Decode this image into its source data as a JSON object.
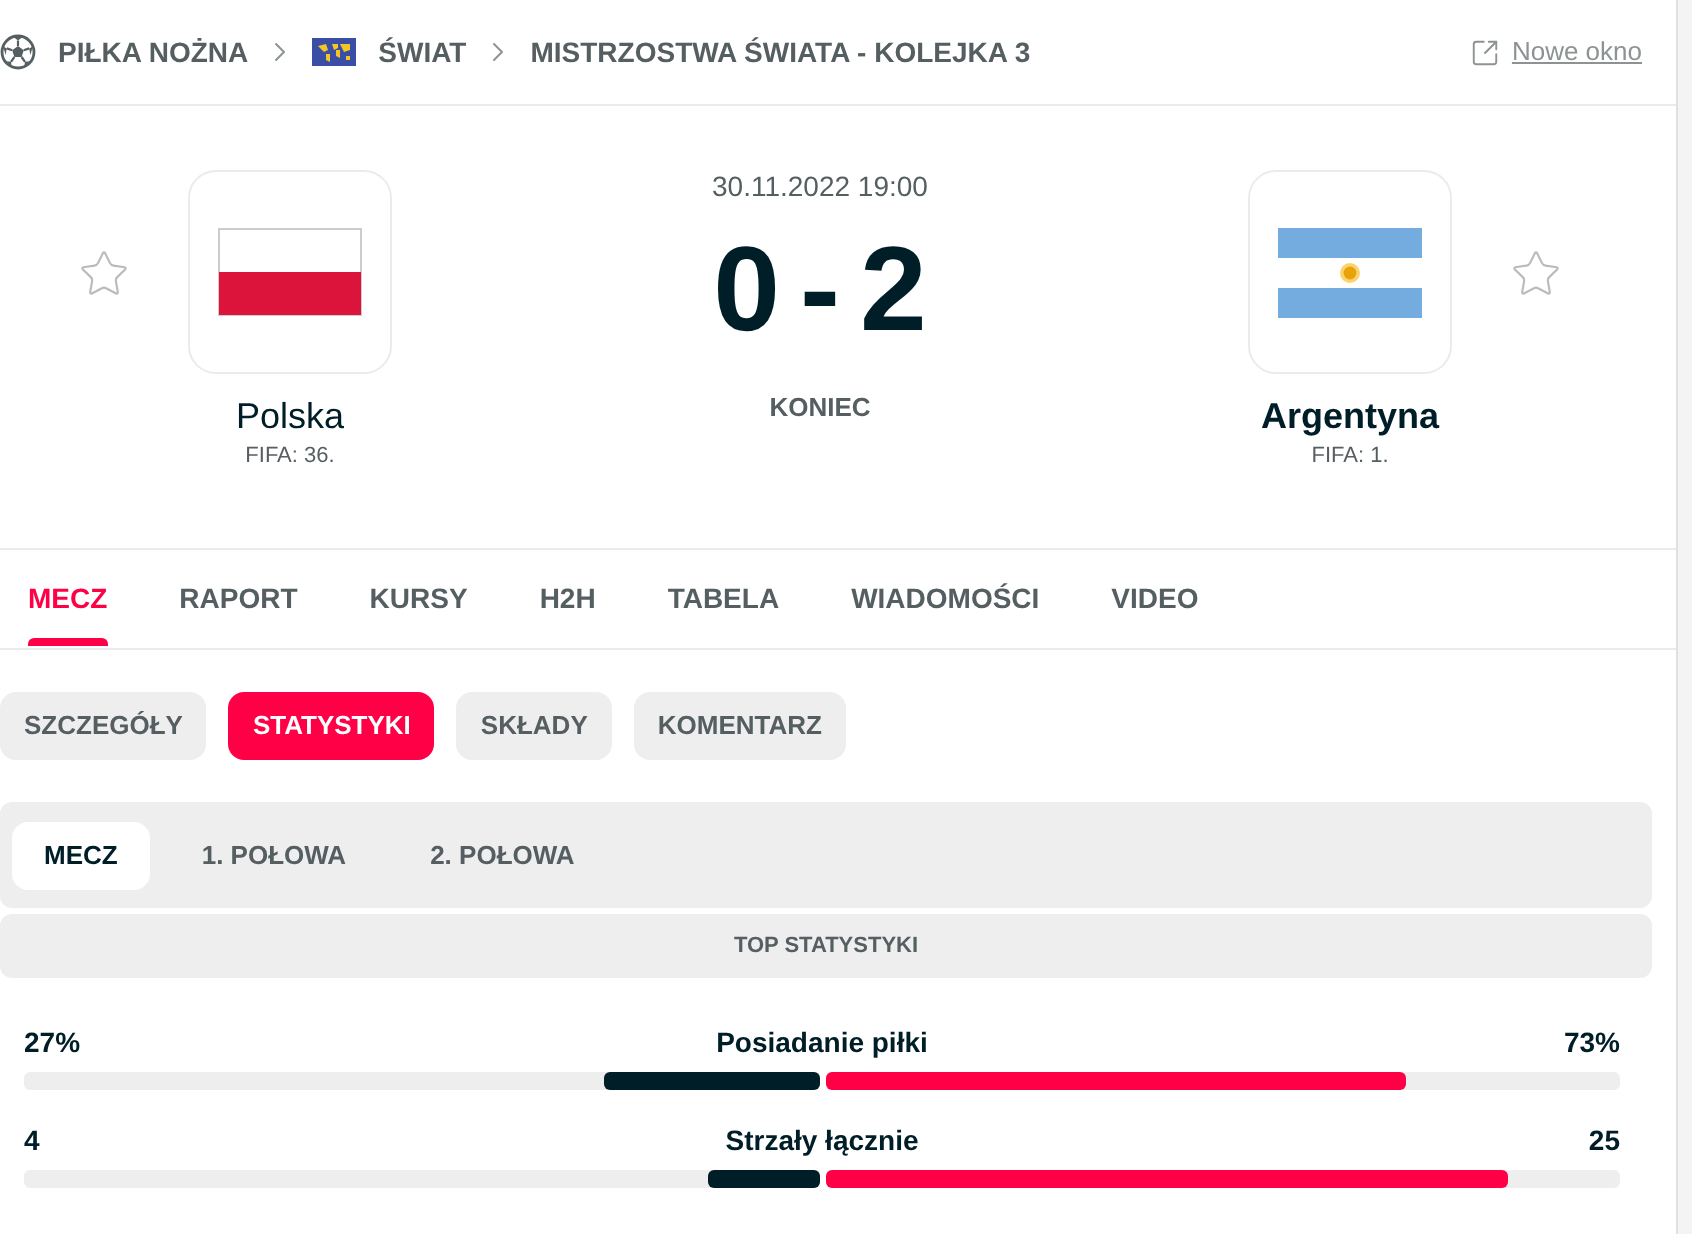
{
  "breadcrumb": {
    "items": [
      {
        "label": "PIŁKA NOŻNA",
        "kind": "sport"
      },
      {
        "label": "ŚWIAT",
        "kind": "region"
      },
      {
        "label": "MISTRZOSTWA ŚWIATA - KOLEJKA 3",
        "kind": "tournament"
      }
    ],
    "new_window": "Nowe okno"
  },
  "match": {
    "date": "30.11.2022 19:00",
    "score_home": "0",
    "score_separator": "-",
    "score_away": "2",
    "status": "KONIEC"
  },
  "teams": [
    {
      "name": "Polska",
      "rank": "FIFA: 36.",
      "kind": "poland",
      "winner": false,
      "favorite": false
    },
    {
      "name": "Argentyna",
      "rank": "FIFA: 1.",
      "kind": "argentina",
      "winner": true,
      "favorite": false
    }
  ],
  "tabs": [
    {
      "label": "MECZ",
      "selected": true
    },
    {
      "label": "RAPORT",
      "selected": false
    },
    {
      "label": "KURSY",
      "selected": false
    },
    {
      "label": "H2H",
      "selected": false
    },
    {
      "label": "TABELA",
      "selected": false
    },
    {
      "label": "WIADOMOŚCI",
      "selected": false
    },
    {
      "label": "VIDEO",
      "selected": false
    }
  ],
  "subtabs": [
    {
      "label": "SZCZEGÓŁY",
      "selected": false
    },
    {
      "label": "STATYSTYKI",
      "selected": true
    },
    {
      "label": "SKŁADY",
      "selected": false
    },
    {
      "label": "KOMENTARZ",
      "selected": false
    }
  ],
  "periods": [
    {
      "label": "MECZ",
      "selected": true
    },
    {
      "label": "1. POŁOWA",
      "selected": false
    },
    {
      "label": "2. POŁOWA",
      "selected": false
    }
  ],
  "stats_header": "TOP STATYSTYKI",
  "stats": [
    {
      "name": "Posiadanie piłki",
      "home": "27%",
      "away": "73%",
      "home_bar": {
        "level": 0.27
      },
      "away_bar": {
        "level": 0.73
      }
    },
    {
      "name": "Strzały łącznie",
      "home": "4",
      "away": "25",
      "home_bar": {
        "level": 0.14
      },
      "away_bar": {
        "level": 0.86
      }
    }
  ]
}
